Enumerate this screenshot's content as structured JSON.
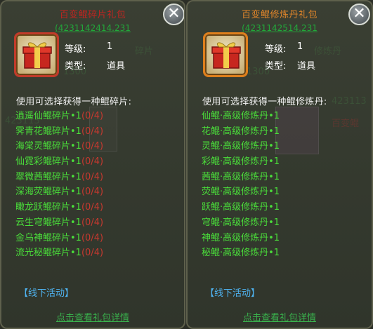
{
  "left": {
    "title": "百变鲲碎片礼包",
    "subtitle": "(4231142414.231",
    "close_glyph": "✕",
    "level_label": "等级:",
    "level_value": "1",
    "type_label": "类型:",
    "type_value": "道具",
    "hint": "使用可选择获得一种鲲碎片:",
    "items": [
      {
        "name": "逍遥仙鲲碎片",
        "qty": "•1",
        "count": "(0/4)"
      },
      {
        "name": "霁青花鲲碎片",
        "qty": "•1",
        "count": "(0/4)"
      },
      {
        "name": "海棠灵鲲碎片",
        "qty": "•1",
        "count": "(0/4)"
      },
      {
        "name": "仙霓彩鲲碎片",
        "qty": "•1",
        "count": "(0/4)"
      },
      {
        "name": "翠微茜鲲碎片",
        "qty": "•1",
        "count": "(0/4)"
      },
      {
        "name": "深海荧鲲碎片",
        "qty": "•1",
        "count": "(0/4)"
      },
      {
        "name": "瞰龙跃鲲碎片",
        "qty": "•1",
        "count": "(0/4)"
      },
      {
        "name": "云生穹鲲碎片",
        "qty": "•1",
        "count": "(0/4)"
      },
      {
        "name": "金乌神鲲碎片",
        "qty": "•1",
        "count": "(0/4)"
      },
      {
        "name": "流光秘鲲碎片",
        "qty": "•1",
        "count": "(0/4)"
      }
    ],
    "activity_link": "【线下活动】",
    "footer_link": "点击查看礼包详情"
  },
  "right": {
    "title": "百变鲲修炼丹礼包",
    "subtitle": "(4231142514.231",
    "close_glyph": "✕",
    "level_label": "等级:",
    "level_value": "1",
    "type_label": "类型:",
    "type_value": "道具",
    "hint": "使用可选择获得一种鲲修炼丹:",
    "items": [
      {
        "name": "仙鲲·高级修炼丹",
        "qty": "•1"
      },
      {
        "name": "花鲲·高级修炼丹",
        "qty": "•1"
      },
      {
        "name": "灵鲲·高级修炼丹",
        "qty": "•1"
      },
      {
        "name": "彩鲲·高级修炼丹",
        "qty": "•1"
      },
      {
        "name": "茜鲲·高级修炼丹",
        "qty": "•1"
      },
      {
        "name": "荧鲲·高级修炼丹",
        "qty": "•1"
      },
      {
        "name": "跃鲲·高级修炼丹",
        "qty": "•1"
      },
      {
        "name": "穹鲲·高级修炼丹",
        "qty": "•1"
      },
      {
        "name": "神鲲·高级修炼丹",
        "qty": "•1"
      },
      {
        "name": "秘鲲·高级修炼丹",
        "qty": "•1"
      }
    ],
    "activity_link": "【线下活动】",
    "footer_link": "点击查看礼包详情"
  },
  "background": {
    "ghost_left_1": "1300",
    "ghost_left_2": "423113",
    "ghost_left_3": "百变鲲",
    "ghost_right_1": "1300",
    "ghost_right_2": "423113",
    "ghost_right_3": "百变鲲",
    "ghost_mid_1": "碎片",
    "ghost_mid_2": "修炼丹"
  },
  "colors": {
    "left_title": "#c02420",
    "right_title": "#e0852a",
    "item_green": "#4ade3a",
    "count_red": "#c7392f",
    "link_blue": "#4fb3f0"
  }
}
